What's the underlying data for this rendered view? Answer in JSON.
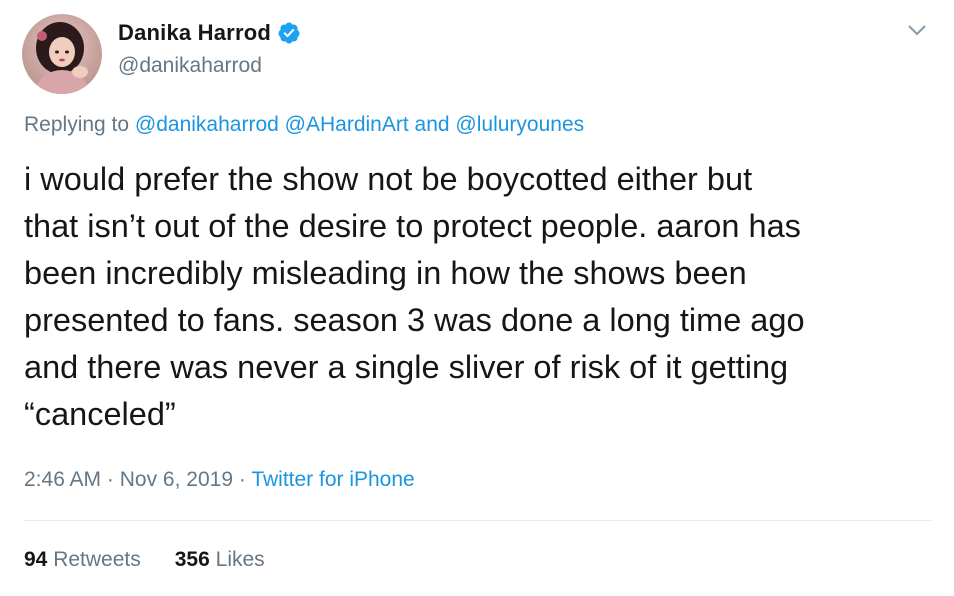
{
  "author": {
    "display_name": "Danika Harrod",
    "handle": "@danikaharrod",
    "verified": true,
    "avatar_icon": "profile-photo-avatar"
  },
  "reply": {
    "prefix": "Replying to",
    "mentions": [
      "@danikaharrod",
      "@AHardinArt"
    ],
    "conjunction": "and",
    "last_mention": "@luluryounes"
  },
  "tweet": {
    "lines": [
      "i would prefer the show not be boycotted either but",
      "that isn’t out of the desire to protect people. aaron has",
      "been incredibly misleading in how the shows been",
      "presented to fans. season 3 was done a long time ago",
      "and there was never a single sliver of risk of it getting",
      "“canceled”"
    ]
  },
  "meta": {
    "time": "2:46 AM",
    "separator": "·",
    "date": "Nov 6, 2019",
    "source": "Twitter for iPhone"
  },
  "stats": {
    "retweets_count": "94",
    "retweets_label": "Retweets",
    "likes_count": "356",
    "likes_label": "Likes"
  },
  "colors": {
    "link_blue": "#1b95e0",
    "secondary_gray": "#657786",
    "text_primary": "#14171a",
    "verified_blue": "#1da1f2",
    "divider": "#e6ecf0"
  }
}
